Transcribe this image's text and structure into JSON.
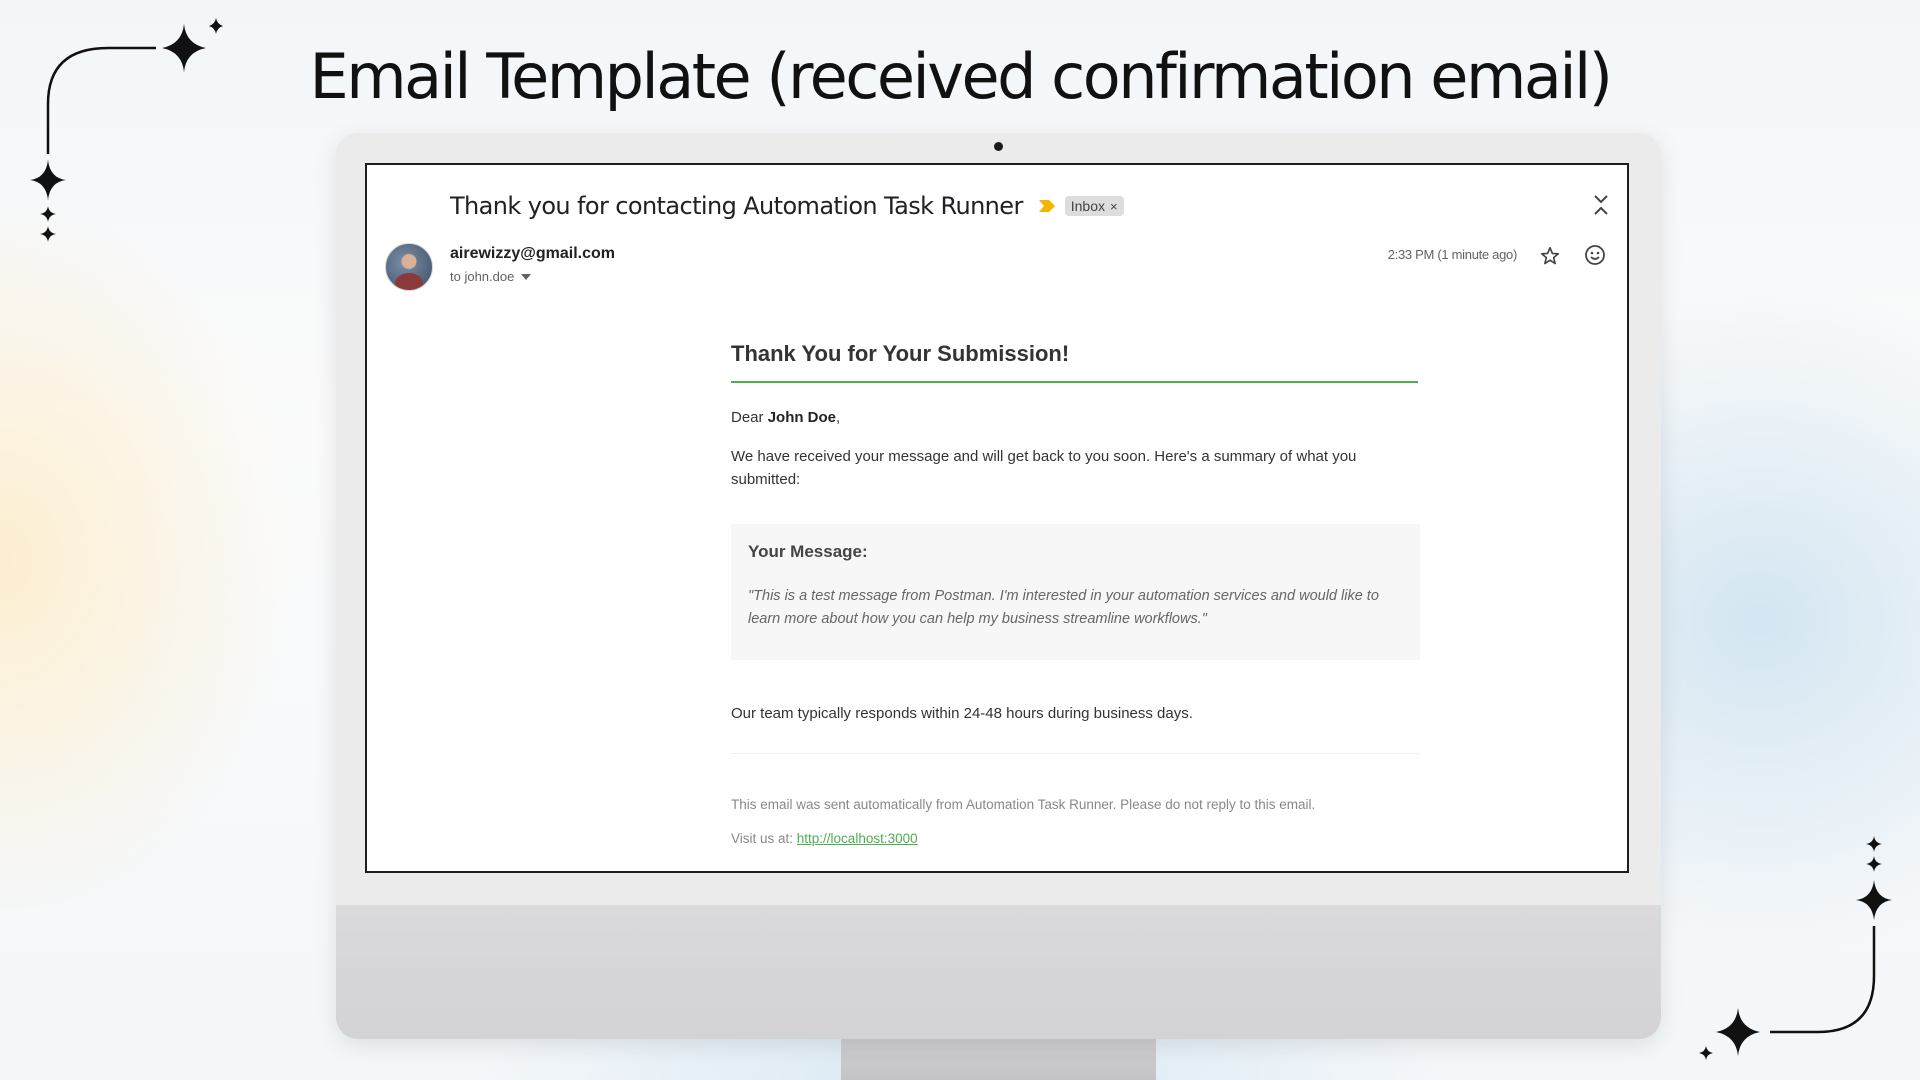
{
  "page": {
    "title": "Email Template (received confirmation email)"
  },
  "email": {
    "subject": "Thank you for contacting Automation Task Runner",
    "label": "Inbox",
    "label_close": "×",
    "sender": "airewizzy@gmail.com",
    "recipient": "to john.doe",
    "time": "2:33 PM (1 minute ago)",
    "body": {
      "heading": "Thank You for Your Submission!",
      "greeting_prefix": "Dear ",
      "recipient_name": "John Doe",
      "greeting_suffix": ",",
      "intro": "We have received your message and will get back to you soon. Here's a summary of what you submitted:",
      "message_heading": "Your Message:",
      "message_text": "\"This is a test message from Postman. I'm interested in your automation services and would like to learn more about how you can help my business streamline workflows.\"",
      "response_note": "Our team typically responds within 24-48 hours during business days.",
      "footer_note": "This email was sent automatically from Automation Task Runner. Please do not reply to this email.",
      "visit_prefix": "Visit us at: ",
      "visit_link": "http://localhost:3000"
    }
  },
  "colors": {
    "accent": "#4caf50",
    "important": "#f4b400"
  },
  "icons": [
    "sparkle-icon",
    "important-marker-icon",
    "collapse-icon",
    "dropdown-arrow-icon",
    "star-icon",
    "emoji-icon"
  ]
}
